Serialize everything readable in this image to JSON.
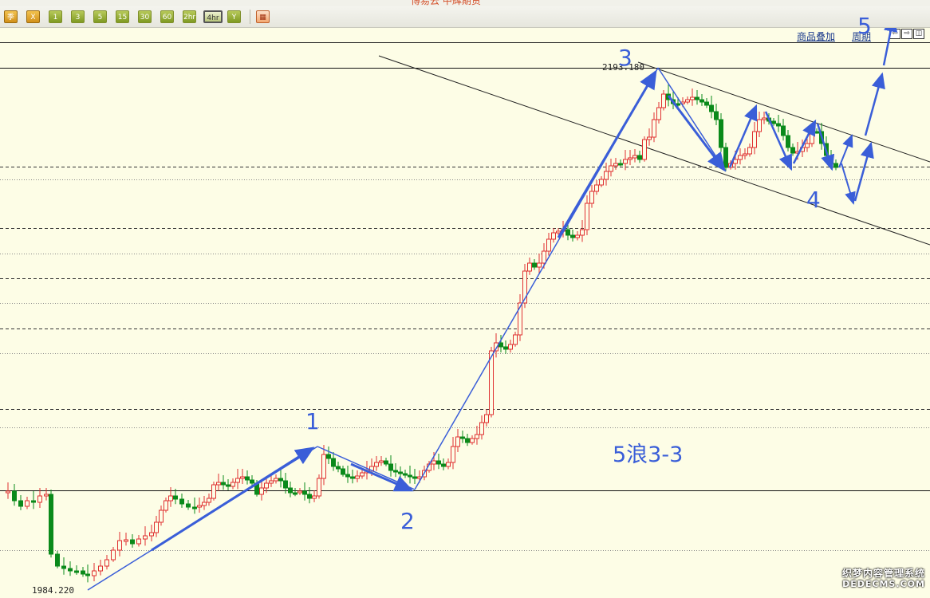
{
  "window": {
    "title_partial": "博易云 中辉期货"
  },
  "toolbar": {
    "buttons": [
      {
        "label": "季",
        "style": "orange"
      },
      {
        "label": "X",
        "style": "orange"
      },
      {
        "label": "1",
        "style": "green"
      },
      {
        "label": "3",
        "style": "green"
      },
      {
        "label": "5",
        "style": "green"
      },
      {
        "label": "15",
        "style": "green"
      },
      {
        "label": "30",
        "style": "green"
      },
      {
        "label": "60",
        "style": "green"
      },
      {
        "label": "2hr",
        "style": "green"
      },
      {
        "label": "4hr",
        "style": "active"
      },
      {
        "label": "Y",
        "style": "green"
      },
      {
        "label": "▦",
        "style": "red"
      }
    ]
  },
  "header_links": {
    "overlay": "商品叠加",
    "period": "周期"
  },
  "window_icons": [
    "restore-left-icon",
    "restore-right-icon",
    "panel-icon"
  ],
  "chart": {
    "high_label": "2193.180",
    "low_label": "1984.220",
    "wave_labels": {
      "w1": "1",
      "w2": "2",
      "w3": "3",
      "w4": "4",
      "w5": "5"
    },
    "annotation": "5浪3-3",
    "colors": {
      "up": "#e03030",
      "down": "#0a8a1a",
      "wave": "#3a5ed8",
      "bg": "#fdfde6"
    }
  },
  "chart_data": {
    "type": "candlestick",
    "marked_high": 2193.18,
    "marked_low": 1984.22,
    "wave_points": [
      "1",
      "2",
      "3",
      "4",
      "5"
    ],
    "annotation": "5浪3-3"
  },
  "watermark": {
    "line1": "织梦内容管理系统",
    "line2": "DEDECMS.COM"
  }
}
